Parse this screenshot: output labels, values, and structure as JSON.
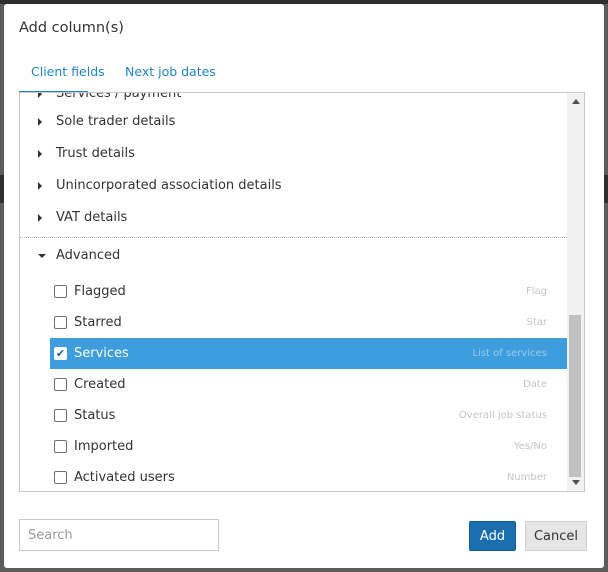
{
  "dialog": {
    "title": "Add column(s)"
  },
  "tabs": [
    {
      "label": "Client fields",
      "active": true
    },
    {
      "label": "Next job dates",
      "active": false
    }
  ],
  "groups": [
    {
      "label": "Services / payment",
      "expanded": false
    },
    {
      "label": "Sole trader details",
      "expanded": false
    },
    {
      "label": "Trust details",
      "expanded": false
    },
    {
      "label": "Unincorporated association details",
      "expanded": false
    },
    {
      "label": "VAT details",
      "expanded": false
    },
    {
      "label": "Advanced",
      "expanded": true
    }
  ],
  "advanced_items": [
    {
      "label": "Flagged",
      "type": "Flag",
      "checked": false
    },
    {
      "label": "Starred",
      "type": "Star",
      "checked": false
    },
    {
      "label": "Services",
      "type": "List of services",
      "checked": true
    },
    {
      "label": "Created",
      "type": "Date",
      "checked": false
    },
    {
      "label": "Status",
      "type": "Overall job status",
      "checked": false
    },
    {
      "label": "Imported",
      "type": "Yes/No",
      "checked": false
    },
    {
      "label": "Activated users",
      "type": "Number",
      "checked": false
    }
  ],
  "check_mark": "✔",
  "search": {
    "placeholder": "Search",
    "value": ""
  },
  "buttons": {
    "add": "Add",
    "cancel": "Cancel"
  },
  "colors": {
    "accent": "#1f84c7",
    "selected_row": "#3e9ddd",
    "primary_button": "#1b6fb0"
  }
}
